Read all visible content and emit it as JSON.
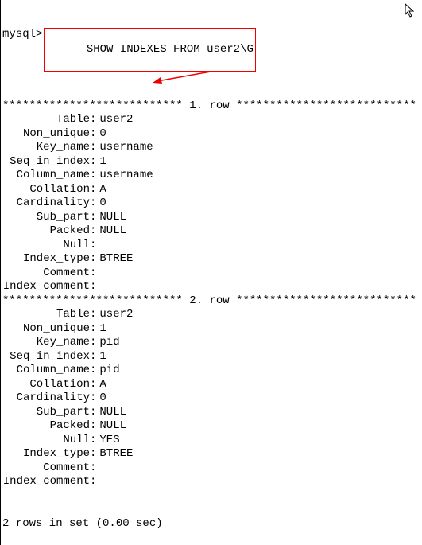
{
  "prompt": "mysql>",
  "command": "SHOW INDEXES FROM user2\\G",
  "row_divider_prefix": "***************************",
  "row_divider_suffix": "***************************",
  "rows": [
    {
      "header": "1. row",
      "fields": [
        {
          "k": "Table",
          "v": "user2"
        },
        {
          "k": "Non_unique",
          "v": "0"
        },
        {
          "k": "Key_name",
          "v": "username"
        },
        {
          "k": "Seq_in_index",
          "v": "1"
        },
        {
          "k": "Column_name",
          "v": "username"
        },
        {
          "k": "Collation",
          "v": "A"
        },
        {
          "k": "Cardinality",
          "v": "0"
        },
        {
          "k": "Sub_part",
          "v": "NULL"
        },
        {
          "k": "Packed",
          "v": "NULL"
        },
        {
          "k": "Null",
          "v": ""
        },
        {
          "k": "Index_type",
          "v": "BTREE"
        },
        {
          "k": "Comment",
          "v": ""
        },
        {
          "k": "Index_comment",
          "v": ""
        }
      ]
    },
    {
      "header": "2. row",
      "fields": [
        {
          "k": "Table",
          "v": "user2"
        },
        {
          "k": "Non_unique",
          "v": "1"
        },
        {
          "k": "Key_name",
          "v": "pid"
        },
        {
          "k": "Seq_in_index",
          "v": "1"
        },
        {
          "k": "Column_name",
          "v": "pid"
        },
        {
          "k": "Collation",
          "v": "A"
        },
        {
          "k": "Cardinality",
          "v": "0"
        },
        {
          "k": "Sub_part",
          "v": "NULL"
        },
        {
          "k": "Packed",
          "v": "NULL"
        },
        {
          "k": "Null",
          "v": "YES"
        },
        {
          "k": "Index_type",
          "v": "BTREE"
        },
        {
          "k": "Comment",
          "v": ""
        },
        {
          "k": "Index_comment",
          "v": ""
        }
      ]
    }
  ],
  "footer": "2 rows in set (0.00 sec)"
}
